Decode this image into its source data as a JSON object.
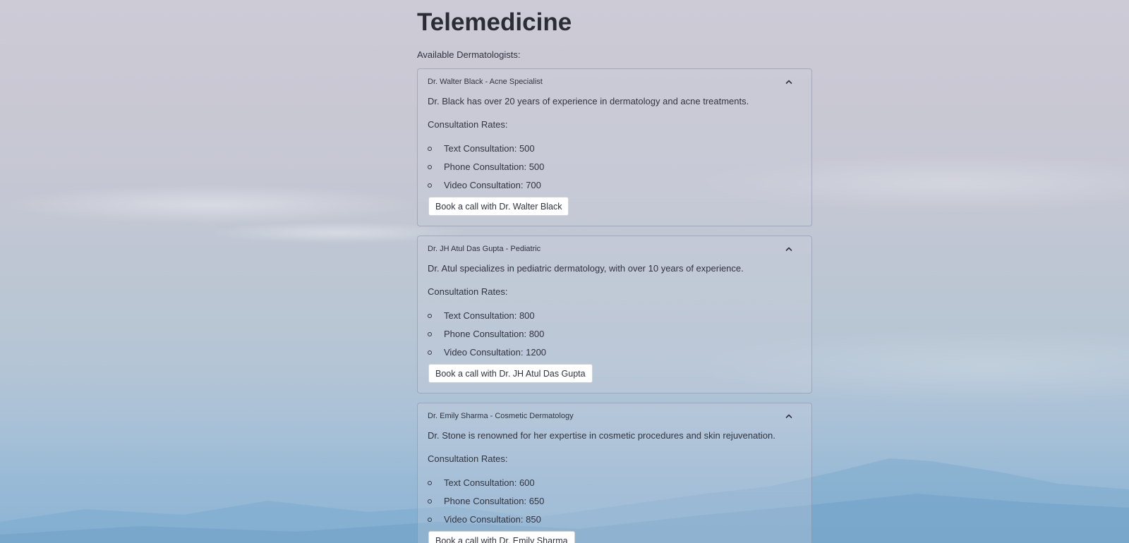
{
  "page": {
    "title": "Telemedicine",
    "intro": "Available Dermatologists:"
  },
  "doctors": [
    {
      "header": "Dr. Walter Black - Acne Specialist",
      "bio": "Dr. Black has over 20 years of experience in dermatology and acne treatments.",
      "rates_label": "Consultation Rates:",
      "rates": [
        "Text Consultation: 500",
        "Phone Consultation: 500",
        "Video Consultation: 700"
      ],
      "button": "Book a call with Dr. Walter Black",
      "expanded": true
    },
    {
      "header": "Dr. JH Atul Das Gupta - Pediatric",
      "bio": "Dr. Atul specializes in pediatric dermatology, with over 10 years of experience.",
      "rates_label": "Consultation Rates:",
      "rates": [
        "Text Consultation: 800",
        "Phone Consultation: 800",
        "Video Consultation: 1200"
      ],
      "button": "Book a call with Dr. JH Atul Das Gupta",
      "expanded": true
    },
    {
      "header": "Dr. Emily Sharma - Cosmetic Dermatology",
      "bio": "Dr. Stone is renowned for her expertise in cosmetic procedures and skin rejuvenation.",
      "rates_label": "Consultation Rates:",
      "rates": [
        "Text Consultation: 600",
        "Phone Consultation: 650",
        "Video Consultation: 850"
      ],
      "button": "Book a call with Dr. Emily Sharma",
      "expanded": true
    }
  ],
  "icons": {
    "expander_toggle": "chevron-up-icon",
    "list_marker": "circle-bullet-icon"
  },
  "colors": {
    "text": "#31333f",
    "button_bg": "#ffffff",
    "sky_top": "#cdcbd6",
    "sky_bottom": "#8db4d4"
  }
}
